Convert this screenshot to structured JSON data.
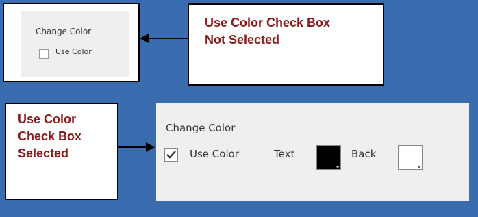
{
  "small_panel": {
    "group_label": "Change Color",
    "checkbox_label": "Use Color",
    "checked": false
  },
  "callout_top": {
    "line1": "Use Color Check Box",
    "line2": "Not Selected"
  },
  "callout_left": {
    "line1": "Use Color",
    "line2": "Check Box",
    "line3": "Selected"
  },
  "large_panel": {
    "group_label": "Change Color",
    "checkbox_label": "Use Color",
    "checked": true,
    "text_label": "Text",
    "text_color": "#000000",
    "back_label": "Back",
    "back_color": "#ffffff"
  },
  "colors": {
    "background": "#3a6db0",
    "callout_text": "#8b1a1a"
  }
}
